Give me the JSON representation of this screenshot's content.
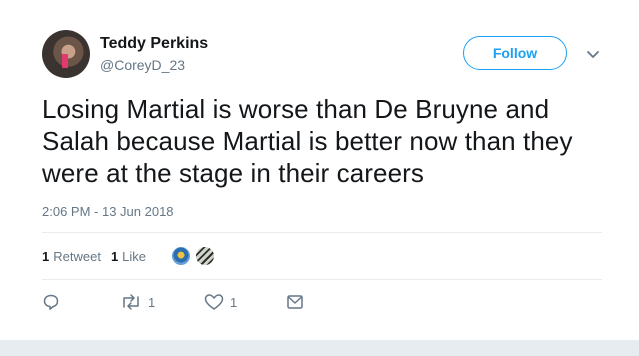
{
  "author": {
    "name": "Teddy Perkins",
    "handle": "@CoreyD_23"
  },
  "follow_button": {
    "label": "Follow"
  },
  "tweet": {
    "text": "Losing Martial is worse than De Bruyne and Salah because Martial is better now than they were at the stage in their careers",
    "timestamp": "2:06 PM - 13 Jun 2018"
  },
  "stats": {
    "retweets_count": "1",
    "retweets_label": "Retweet",
    "likes_count": "1",
    "likes_label": "Like"
  },
  "actions": {
    "reply_count": "",
    "retweet_count": "1",
    "like_count": "1"
  },
  "colors": {
    "accent": "#1da1f2",
    "muted": "#657786",
    "text": "#14171a",
    "divider": "#e6ecf0"
  },
  "icons": [
    "reply-icon",
    "retweet-icon",
    "heart-icon",
    "message-icon",
    "chevron-down-icon"
  ]
}
